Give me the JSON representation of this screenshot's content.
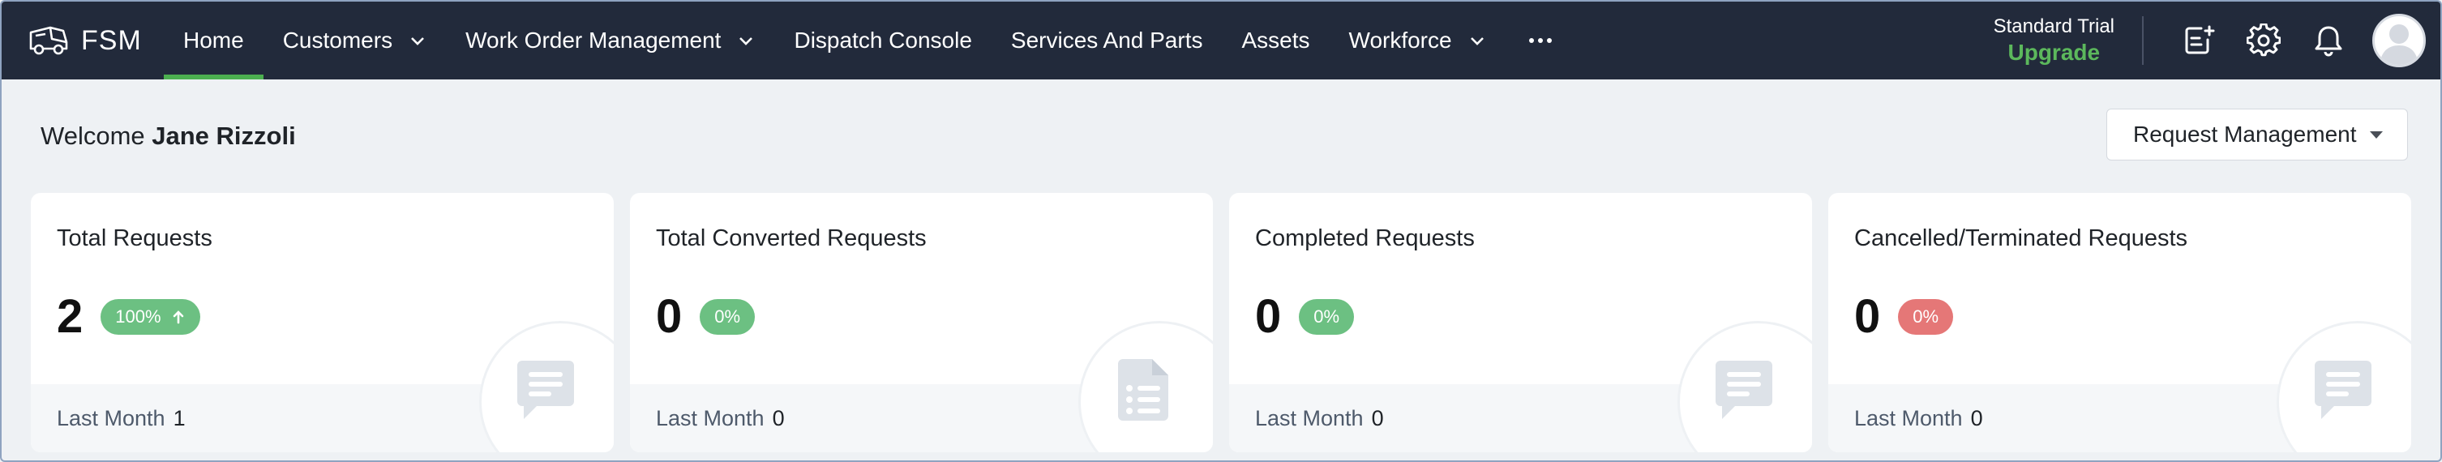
{
  "app": {
    "brand": "FSM"
  },
  "nav": {
    "items": [
      {
        "label": "Home",
        "active": true,
        "has_menu": false
      },
      {
        "label": "Customers",
        "active": false,
        "has_menu": true
      },
      {
        "label": "Work Order Management",
        "active": false,
        "has_menu": true
      },
      {
        "label": "Dispatch Console",
        "active": false,
        "has_menu": false
      },
      {
        "label": "Services And Parts",
        "active": false,
        "has_menu": false
      },
      {
        "label": "Assets",
        "active": false,
        "has_menu": false
      },
      {
        "label": "Workforce",
        "active": false,
        "has_menu": true
      }
    ],
    "more_icon": "more-horizontal-icon"
  },
  "header_right": {
    "trial_label": "Standard Trial",
    "upgrade_label": "Upgrade",
    "icons": [
      "new-note-icon",
      "gear-icon",
      "bell-icon",
      "avatar"
    ]
  },
  "welcome": {
    "prefix": "Welcome",
    "name": "Jane Rizzoli"
  },
  "view_selector": {
    "selected": "Request Management"
  },
  "cards": [
    {
      "title": "Total Requests",
      "value": "2",
      "badge": "100%",
      "badge_color": "#6cc082",
      "trend": "up",
      "footer_label": "Last Month",
      "footer_value": "1",
      "icon": "chat-icon"
    },
    {
      "title": "Total Converted Requests",
      "value": "0",
      "badge": "0%",
      "badge_color": "#6cc082",
      "trend": "",
      "footer_label": "Last Month",
      "footer_value": "0",
      "icon": "document-list-icon"
    },
    {
      "title": "Completed Requests",
      "value": "0",
      "badge": "0%",
      "badge_color": "#6cc082",
      "trend": "",
      "footer_label": "Last Month",
      "footer_value": "0",
      "icon": "chat-icon"
    },
    {
      "title": "Cancelled/Terminated Requests",
      "value": "0",
      "badge": "0%",
      "badge_color": "#e57777",
      "trend": "",
      "footer_label": "Last Month",
      "footer_value": "0",
      "icon": "chat-icon"
    }
  ],
  "colors": {
    "topbar": "#222a3b",
    "accent": "#4caf50",
    "upgrade": "#5cb85c",
    "page_bg": "#eef1f4"
  }
}
